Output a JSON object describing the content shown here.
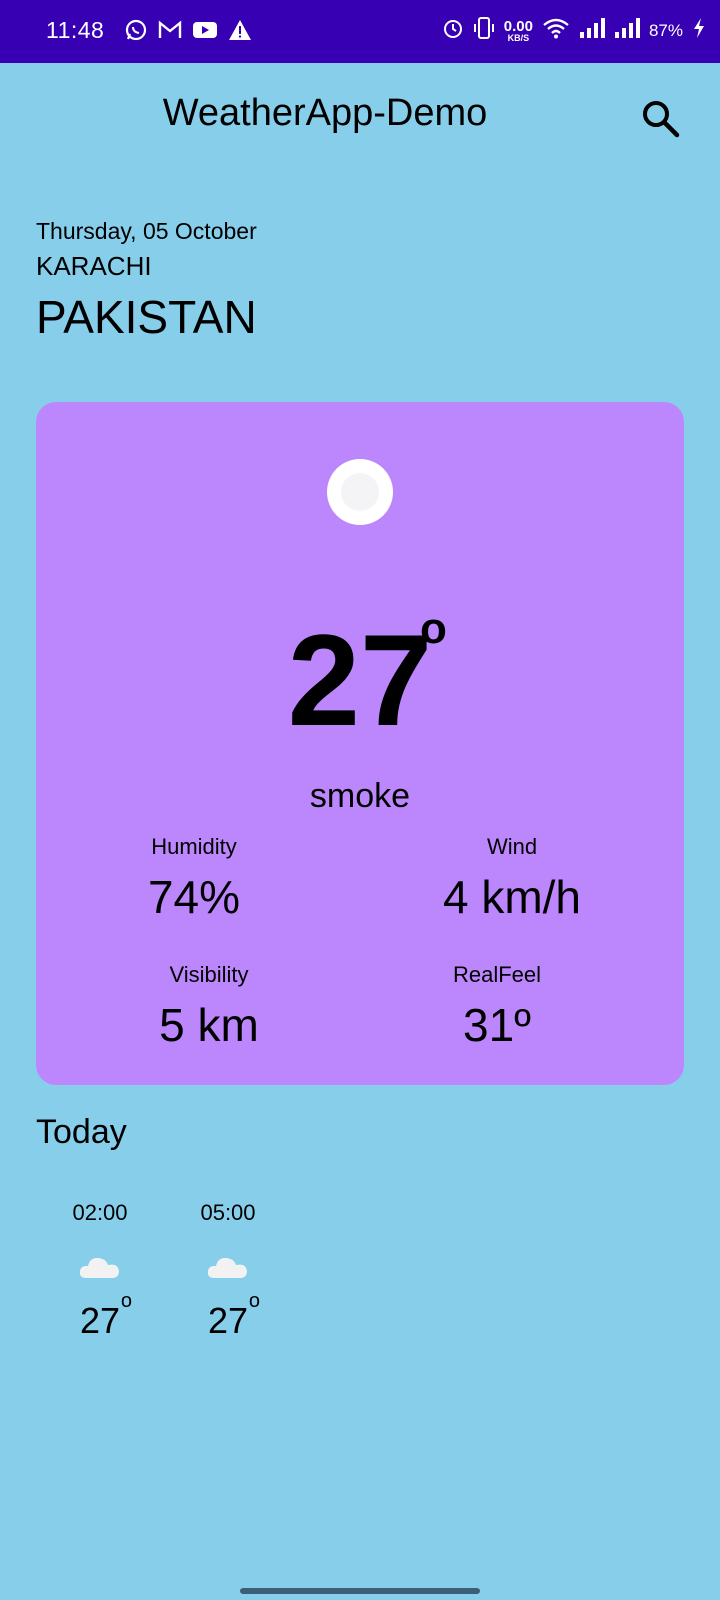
{
  "status_bar": {
    "time": "11:48",
    "net_speed_value": "0.00",
    "net_speed_unit": "KB/S",
    "battery": "87%",
    "left_icons": [
      "whatsapp-icon",
      "gmail-icon",
      "youtube-icon",
      "warning-icon"
    ],
    "right_icons": [
      "alarm-icon",
      "vibrate-icon",
      "wifi-icon",
      "signal-icon",
      "signal-icon",
      "charging-icon"
    ]
  },
  "app_bar": {
    "title": "WeatherApp-Demo",
    "search_icon": "search-icon"
  },
  "location": {
    "date": "Thursday, 05 October",
    "city": "KARACHI",
    "country": "PAKISTAN"
  },
  "current": {
    "icon": "weather-icon",
    "temperature": "27",
    "degree_symbol": "o",
    "condition": "smoke",
    "stats": {
      "humidity_label": "Humidity",
      "humidity_value": "74%",
      "wind_label": "Wind",
      "wind_value": "4 km/h",
      "visibility_label": "Visibility",
      "visibility_value": "5 km",
      "realfeel_label": "RealFeel",
      "realfeel_value": "31º"
    }
  },
  "today": {
    "title": "Today",
    "hours": [
      {
        "time": "02:00",
        "icon": "cloud-icon",
        "temp": "27",
        "degree": "o"
      },
      {
        "time": "05:00",
        "icon": "cloud-icon",
        "temp": "27",
        "degree": "o"
      }
    ]
  },
  "colors": {
    "status_bar": "#3700B3",
    "background": "#87CEEB",
    "card": "#BC87FC"
  }
}
